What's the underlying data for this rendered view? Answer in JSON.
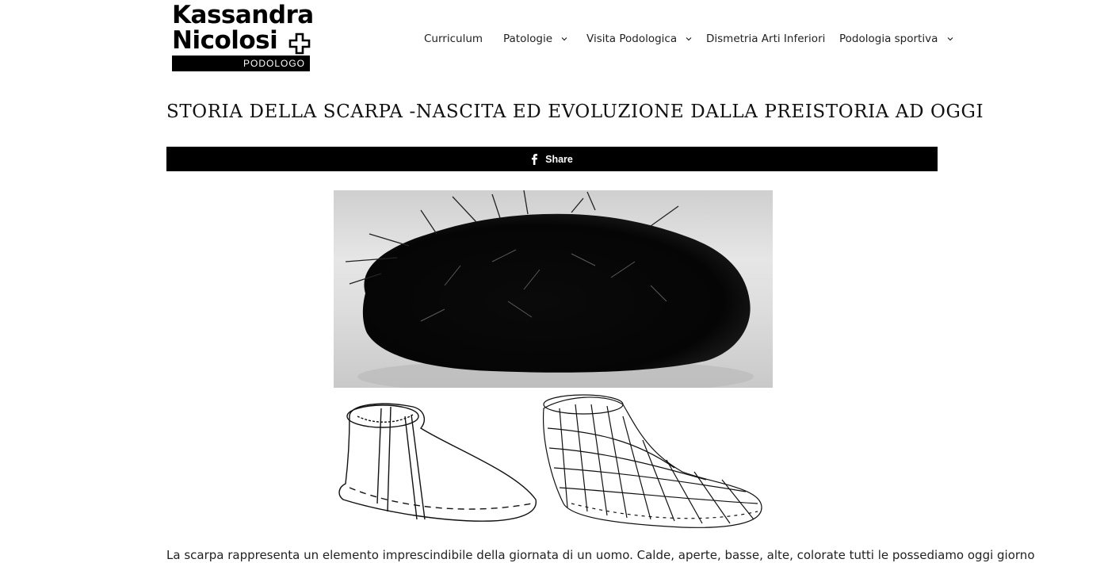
{
  "logo": {
    "line1": "Kassandra",
    "line2": "Nicolosi",
    "subtitle": "PODOLOGO"
  },
  "nav": {
    "items": [
      {
        "label": "Curriculum",
        "has_dropdown": false
      },
      {
        "label": "Patologie",
        "has_dropdown": true
      },
      {
        "label": "Visita Podologica",
        "has_dropdown": true
      },
      {
        "label": "Dismetria Arti Inferiori",
        "has_dropdown": false
      },
      {
        "label": "Podologia sportiva",
        "has_dropdown": true
      }
    ]
  },
  "article": {
    "title": "STORIA DELLA SCARPA -NASCITA ED EVOLUZIONE DALLA PREISTORIA AD OGGI",
    "share_label": "Share",
    "intro": "La scarpa rappresenta un elemento imprescindibile della giornata di un uomo. Calde, aperte, basse, alte, colorate tutti le possediamo oggi giorno"
  },
  "colors": {
    "share_bar": "#000000",
    "text": "#111111",
    "background": "#ffffff"
  },
  "icons": {
    "share": "facebook-icon",
    "dropdown": "chevron-down-icon",
    "logo_mark": "plus-cross-icon"
  }
}
